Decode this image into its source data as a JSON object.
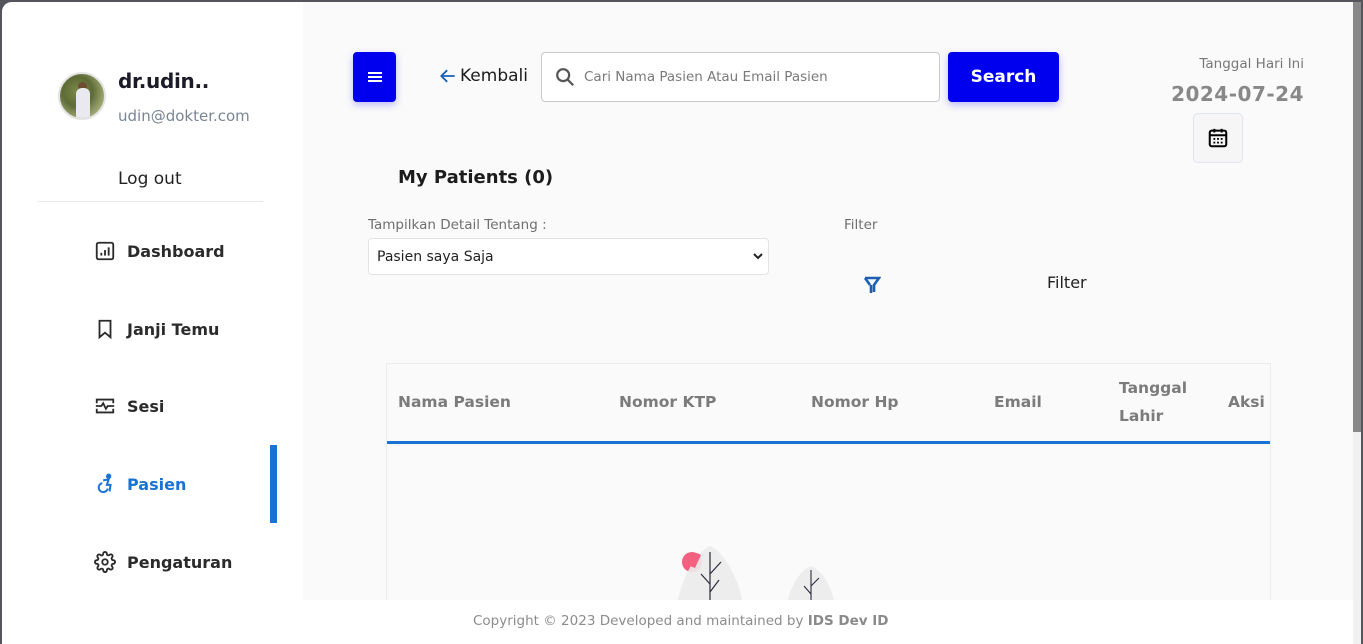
{
  "user": {
    "name": "dr.udin..",
    "email": "udin@dokter.com",
    "logout_label": "Log out"
  },
  "sidebar": {
    "items": [
      {
        "label": "Dashboard",
        "icon": "dashboard-chart-icon",
        "active": false
      },
      {
        "label": "Janji Temu",
        "icon": "bookmark-icon",
        "active": false
      },
      {
        "label": "Sesi",
        "icon": "activity-monitor-icon",
        "active": false
      },
      {
        "label": "Pasien",
        "icon": "accessible-person-icon",
        "active": true
      },
      {
        "label": "Pengaturan",
        "icon": "gear-icon",
        "active": false
      }
    ],
    "accent_color": "#1a73d4"
  },
  "topbar": {
    "menu_icon": "hamburger-menu-icon",
    "back_label": "Kembali",
    "search_placeholder": "Cari Nama Pasien Atau Email Pasien",
    "search_value": "",
    "search_button": "Search",
    "date_label": "Tanggal Hari Ini",
    "date_value": "2024-07-24",
    "primary_color": "#0000ee"
  },
  "main": {
    "title": "My Patients (0)",
    "detail_label": "Tampilkan Detail Tentang :",
    "detail_selected": "Pasien saya Saja",
    "filter_label": "Filter",
    "filter_button": "Filter",
    "table": {
      "columns": [
        "Nama Pasien",
        "Nomor KTP",
        "Nomor Hp",
        "Email",
        "Tanggal Lahir",
        "Aksi"
      ],
      "rows": []
    }
  },
  "footer": {
    "text": "Copyright © 2023 Developed and maintained by ",
    "brand": "IDS Dev ID"
  }
}
